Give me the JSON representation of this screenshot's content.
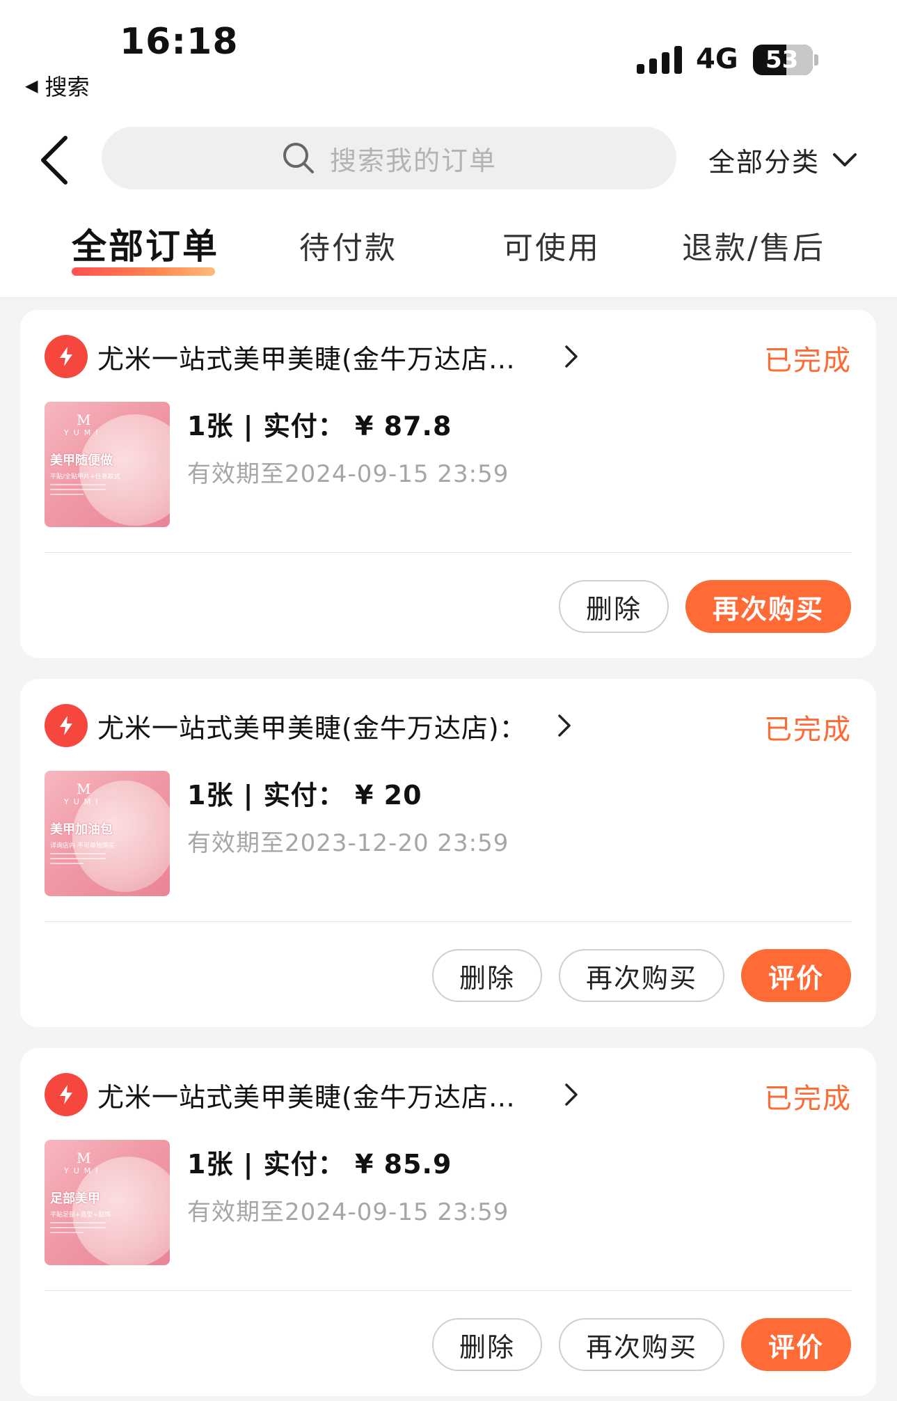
{
  "status_bar": {
    "time": "16:18",
    "back_app": "搜索",
    "network": "4G",
    "battery": "53"
  },
  "nav": {
    "search_placeholder": "搜索我的订单",
    "category": "全部分类",
    "tabs": [
      {
        "label": "全部订单",
        "active": true
      },
      {
        "label": "待付款",
        "active": false
      },
      {
        "label": "可使用",
        "active": false
      },
      {
        "label": "退款/售后",
        "active": false
      }
    ]
  },
  "colors": {
    "accent": "#ff6b36",
    "status": "#ff6a33",
    "logo": "#f5473e"
  },
  "orders": [
    {
      "shop_title": "尤米一站式美甲美睫(金牛万达店)：甲片+造型…",
      "status": "已完成",
      "thumb": {
        "brand": "YUMI",
        "title": "美甲随便做",
        "sub": "平贴/全贴甲片+任意款式"
      },
      "qty_line": "1张 | 实付： ¥ 87.8",
      "expire": "有效期至2024-09-15 23:59",
      "buttons": [
        "删除",
        "再次购买"
      ]
    },
    {
      "shop_title": "尤米一站式美甲美睫(金牛万达店)：美甲加油包一",
      "status": "已完成",
      "thumb": {
        "brand": "YUMI",
        "title": "美甲加油包",
        "sub": "详询店内 不可单独购买"
      },
      "qty_line": "1张 | 实付： ¥ 20",
      "expire": "有效期至2023-12-20 23:59",
      "buttons": [
        "删除",
        "再次购买",
        "评价"
      ]
    },
    {
      "shop_title": "尤米一站式美甲美睫(金牛万达店)：【足部美甲…",
      "status": "已完成",
      "thumb": {
        "brand": "YUMI",
        "title": "足部美甲",
        "sub": "平贴足部+造型+贴饰"
      },
      "qty_line": "1张 | 实付： ¥ 85.9",
      "expire": "有效期至2024-09-15 23:59",
      "buttons": [
        "删除",
        "再次购买",
        "评价"
      ]
    }
  ]
}
